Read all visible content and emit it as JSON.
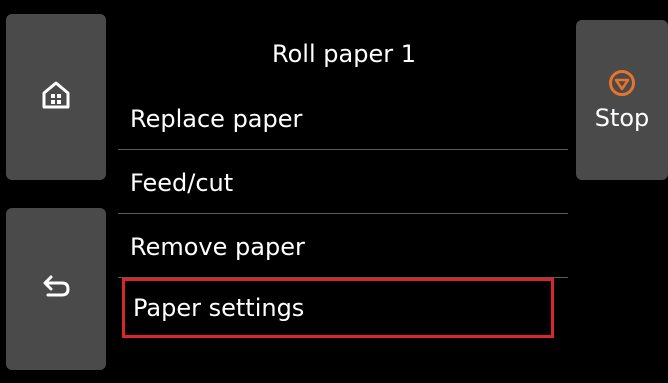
{
  "screen_title": "Roll paper 1",
  "menu_items": [
    {
      "label": "Replace paper"
    },
    {
      "label": "Feed/cut"
    },
    {
      "label": "Remove paper"
    },
    {
      "label": "Paper settings",
      "highlighted": true
    }
  ],
  "side_buttons": {
    "home": {
      "icon": "home-icon"
    },
    "back": {
      "icon": "back-arrow-icon"
    },
    "stop": {
      "label": "Stop",
      "icon": "stop-icon",
      "icon_color": "#e8732a"
    }
  },
  "colors": {
    "background": "#000000",
    "button_background": "#4a4a4a",
    "highlight_border": "#d9262c",
    "divider": "#5a5a5a"
  }
}
